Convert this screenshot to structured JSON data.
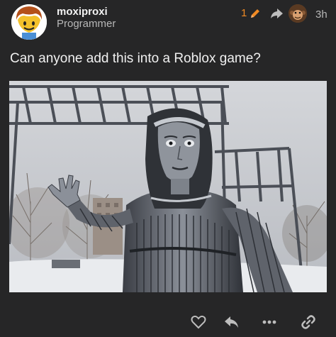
{
  "post": {
    "username": "moxiproxi",
    "user_title": "Programmer",
    "edit_count": "1",
    "timestamp": "3h",
    "body": "Can anyone add this into a Roblox game?"
  },
  "icons": {
    "edit": "pencil-icon",
    "share": "share-icon",
    "like": "heart-icon",
    "reply": "reply-icon",
    "more": "more-icon",
    "link": "link-icon"
  },
  "colors": {
    "background": "#262627",
    "accent": "#f08a24",
    "text": "#f0f0f0",
    "muted": "#b8b8b8"
  }
}
